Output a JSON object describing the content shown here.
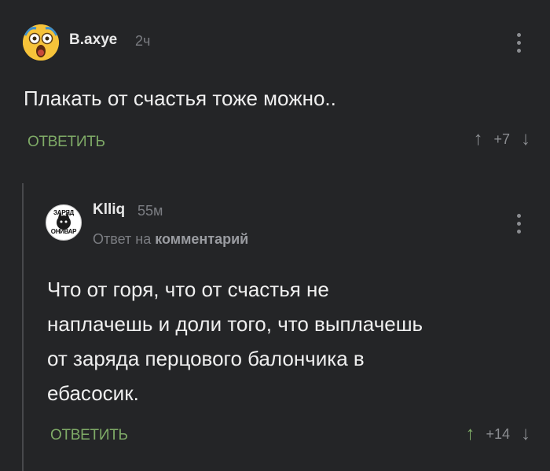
{
  "comments": [
    {
      "author": "В.ахуе",
      "time": "2ч",
      "avatar": "screaming-face-icon",
      "text": "Плакать от счастья тоже можно..",
      "reply_label": "ОТВЕТИТЬ",
      "rating": "+7",
      "upvoted": false
    },
    {
      "author": "Klliq",
      "time": "55м",
      "avatar_text_top": "ЗАРЯД",
      "avatar_text_bottom": "ОНИВАР",
      "reply_to_prefix": "Ответ на",
      "reply_to_link": "комментарий",
      "text": "Что от горя, что от счастья не\nнаплачешь и доли того, что выплачешь\nот заряда перцового балончика в\nебасосик.",
      "reply_label": "ОТВЕТИТЬ",
      "rating": "+14",
      "upvoted": true
    }
  ],
  "colors": {
    "background": "#242527",
    "accent_green": "#7fab67",
    "muted": "#7b7d82"
  },
  "icons": {
    "upvote": "↑",
    "downvote": "↓",
    "more": "vertical-dots-icon"
  }
}
